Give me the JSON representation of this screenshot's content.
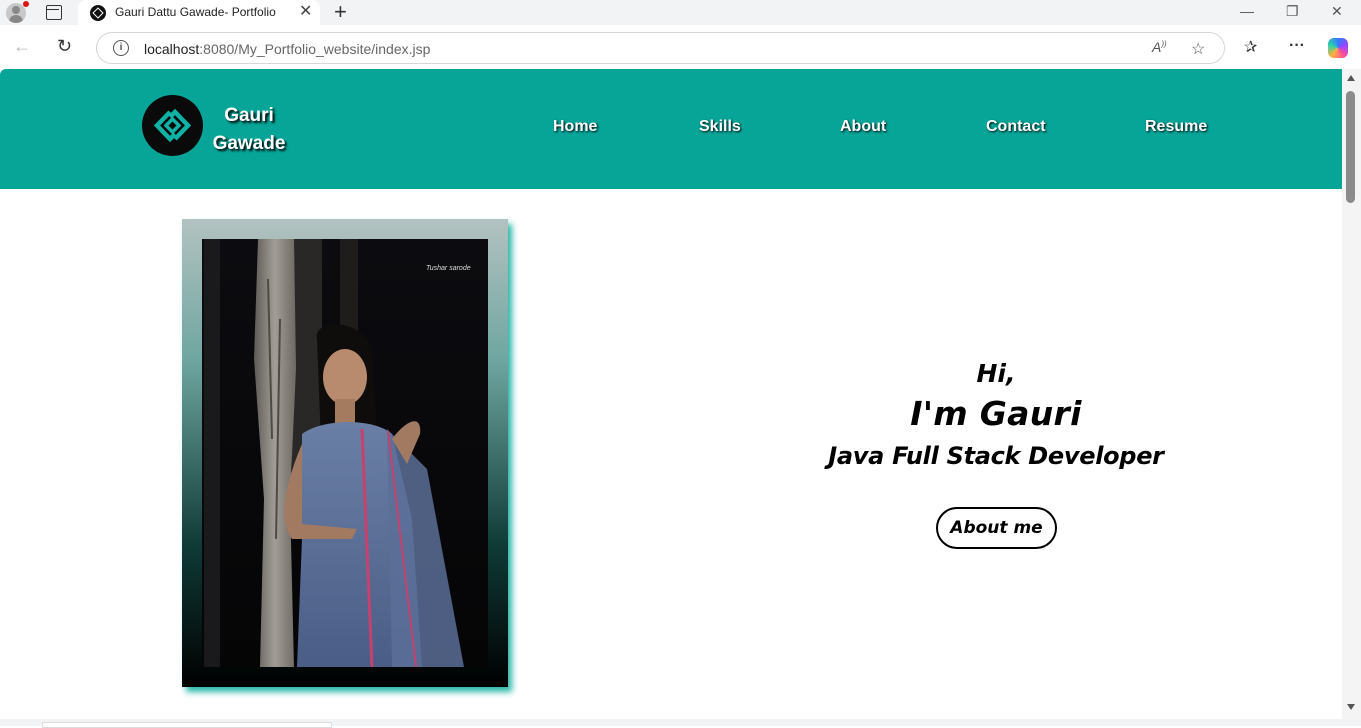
{
  "browser": {
    "tab_title": "Gauri Dattu Gawade- Portfolio",
    "new_tab_symbol": "+",
    "url_host": "localhost",
    "url_rest": ":8080/My_Portfolio_website/index.jsp"
  },
  "header": {
    "brand_first": "Gauri",
    "brand_last": "Gawade",
    "nav": [
      "Home",
      "Skills",
      "About",
      "Contact",
      "Resume"
    ],
    "bg_color": "#06a598"
  },
  "hero": {
    "greeting": "Hi,",
    "intro": "I'm Gauri",
    "role": "Java Full Stack Developer",
    "button_label": "About me",
    "photo_credit": "Tushar sarode"
  }
}
